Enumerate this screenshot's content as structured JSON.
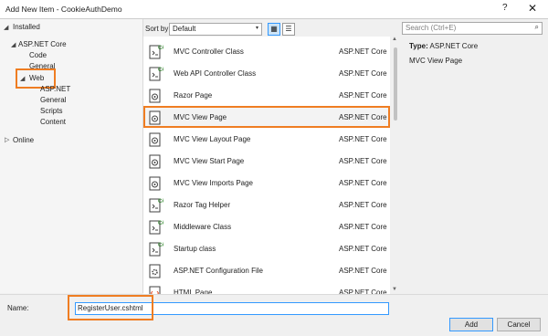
{
  "window": {
    "title": "Add New Item - CookieAuthDemo",
    "help_label": "?",
    "close_glyph": "✕"
  },
  "tree": {
    "installed": "Installed",
    "aspnet_core": "ASP.NET Core",
    "code": "Code",
    "general": "General",
    "web": "Web",
    "web_aspnet": "ASP.NET",
    "web_general": "General",
    "scripts": "Scripts",
    "content": "Content",
    "online": "Online",
    "expanded_glyph": "◢",
    "collapsed_glyph": "▷"
  },
  "toolbar": {
    "sort_label": "Sort by:",
    "sort_value": "Default",
    "sort_arrow": "▾",
    "grid_view_glyph": "▦",
    "list_view_glyph": "☰"
  },
  "search": {
    "placeholder": "Search (Ctrl+E)",
    "icon_glyph": "⌕"
  },
  "templates": [
    {
      "name": "MVC Controller Class",
      "category": "ASP.NET Core",
      "icon": "csharp-file-icon"
    },
    {
      "name": "Web API Controller Class",
      "category": "ASP.NET Core",
      "icon": "csharp-file-icon"
    },
    {
      "name": "Razor Page",
      "category": "ASP.NET Core",
      "icon": "razor-page-icon"
    },
    {
      "name": "MVC View Page",
      "category": "ASP.NET Core",
      "icon": "razor-page-icon",
      "selected": true
    },
    {
      "name": "MVC View Layout Page",
      "category": "ASP.NET Core",
      "icon": "razor-page-icon"
    },
    {
      "name": "MVC View Start Page",
      "category": "ASP.NET Core",
      "icon": "razor-page-icon"
    },
    {
      "name": "MVC View Imports Page",
      "category": "ASP.NET Core",
      "icon": "razor-page-icon"
    },
    {
      "name": "Razor Tag Helper",
      "category": "ASP.NET Core",
      "icon": "csharp-file-icon"
    },
    {
      "name": "Middleware Class",
      "category": "ASP.NET Core",
      "icon": "csharp-file-icon"
    },
    {
      "name": "Startup class",
      "category": "ASP.NET Core",
      "icon": "csharp-file-icon"
    },
    {
      "name": "ASP.NET Configuration File",
      "category": "ASP.NET Core",
      "icon": "config-file-icon"
    },
    {
      "name": "HTML Page",
      "category": "ASP.NET Core",
      "icon": "html-file-icon"
    }
  ],
  "details": {
    "type_label": "Type:",
    "type_value": "ASP.NET Core",
    "description": "MVC View Page"
  },
  "footer": {
    "name_label": "Name:",
    "name_value": "RegisterUser.cshtml",
    "add_label": "Add",
    "cancel_label": "Cancel"
  },
  "colors": {
    "highlight_outline": "#ef7d22",
    "csharp_badge": "#388a34",
    "focus_border": "#3399ff"
  }
}
